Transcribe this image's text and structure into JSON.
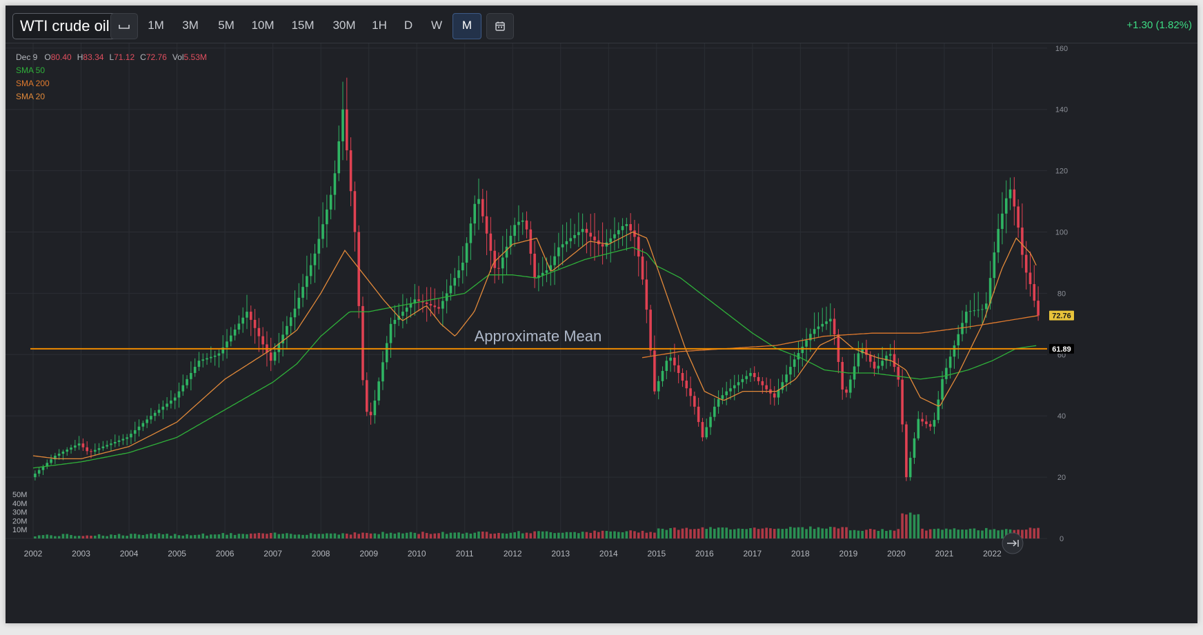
{
  "toolbar": {
    "symbol": "WTI crude oil",
    "intervals": [
      "1M",
      "3M",
      "5M",
      "10M",
      "15M",
      "30M",
      "1H",
      "D",
      "W",
      "M"
    ],
    "active_interval": "M",
    "change": "+1.30 (1.82%)"
  },
  "legend": {
    "date": "Dec 9",
    "open_label": "O",
    "open": "80.40",
    "high_label": "H",
    "high": "83.34",
    "low_label": "L",
    "low": "71.12",
    "close_label": "C",
    "close": "72.76",
    "vol_label": "Vol",
    "vol": "5.53M",
    "sma50": "SMA 50",
    "sma200": "SMA 200",
    "sma20": "SMA 20"
  },
  "annotation": "Approximate Mean",
  "colors": {
    "background": "#1f2126",
    "up": "#2fb463",
    "down": "#e04152",
    "sma50": "#2fb13a",
    "sma200": "#e07a2e",
    "sma20": "#e38a3a",
    "mean_line": "#f08c00",
    "grid": "#2b2e34"
  },
  "icons": [
    "range-icon",
    "calendar-icon",
    "scroll-to-latest-icon"
  ],
  "chart_data": {
    "type": "candlestick",
    "interval": "monthly",
    "x_labels": [
      "2002",
      "2003",
      "2004",
      "2005",
      "2006",
      "2007",
      "2008",
      "2009",
      "2010",
      "2011",
      "2012",
      "2013",
      "2014",
      "2015",
      "2016",
      "2017",
      "2018",
      "2019",
      "2020",
      "2021",
      "2022"
    ],
    "ylim": [
      0,
      160
    ],
    "y_ticks": [
      0,
      20,
      40,
      60,
      80,
      100,
      120,
      140,
      160
    ],
    "volume_ticks": [
      "50M",
      "40M",
      "30M",
      "20M",
      "10M"
    ],
    "volume_max": 50,
    "mean_line": 61.89,
    "last_close": 72.76,
    "mean_label": "61.89",
    "last_label": "72.76",
    "close_anchors": [
      [
        2002.0,
        20
      ],
      [
        2002.5,
        27
      ],
      [
        2003.0,
        31
      ],
      [
        2003.2,
        28
      ],
      [
        2003.5,
        30
      ],
      [
        2004.0,
        33
      ],
      [
        2004.5,
        40
      ],
      [
        2005.0,
        46
      ],
      [
        2005.5,
        58
      ],
      [
        2005.9,
        60
      ],
      [
        2006.5,
        74
      ],
      [
        2007.0,
        58
      ],
      [
        2007.5,
        75
      ],
      [
        2007.9,
        92
      ],
      [
        2008.3,
        115
      ],
      [
        2008.5,
        140
      ],
      [
        2008.75,
        100
      ],
      [
        2008.95,
        42
      ],
      [
        2009.1,
        40
      ],
      [
        2009.5,
        70
      ],
      [
        2010.0,
        78
      ],
      [
        2010.5,
        75
      ],
      [
        2011.0,
        90
      ],
      [
        2011.3,
        113
      ],
      [
        2011.7,
        86
      ],
      [
        2012.1,
        103
      ],
      [
        2012.3,
        104
      ],
      [
        2012.5,
        85
      ],
      [
        2012.8,
        88
      ],
      [
        2013.0,
        95
      ],
      [
        2013.5,
        101
      ],
      [
        2013.9,
        95
      ],
      [
        2014.4,
        103
      ],
      [
        2014.6,
        98
      ],
      [
        2014.8,
        80
      ],
      [
        2015.0,
        48
      ],
      [
        2015.3,
        60
      ],
      [
        2015.8,
        45
      ],
      [
        2016.0,
        33
      ],
      [
        2016.3,
        45
      ],
      [
        2016.5,
        48
      ],
      [
        2017.0,
        54
      ],
      [
        2017.5,
        46
      ],
      [
        2017.9,
        58
      ],
      [
        2018.3,
        68
      ],
      [
        2018.7,
        72
      ],
      [
        2018.95,
        45
      ],
      [
        2019.3,
        63
      ],
      [
        2019.6,
        55
      ],
      [
        2019.9,
        61
      ],
      [
        2020.1,
        51
      ],
      [
        2020.25,
        20
      ],
      [
        2020.5,
        39
      ],
      [
        2020.8,
        36
      ],
      [
        2021.0,
        52
      ],
      [
        2021.5,
        74
      ],
      [
        2021.9,
        75
      ],
      [
        2022.15,
        100
      ],
      [
        2022.4,
        115
      ],
      [
        2022.55,
        105
      ],
      [
        2022.7,
        89
      ],
      [
        2022.9,
        80
      ],
      [
        2022.95,
        72.76
      ]
    ],
    "sma50_anchors": [
      [
        2002.0,
        23
      ],
      [
        2003.0,
        25
      ],
      [
        2004.0,
        28
      ],
      [
        2005.0,
        33
      ],
      [
        2006.0,
        42
      ],
      [
        2007.0,
        51
      ],
      [
        2007.5,
        57
      ],
      [
        2008.0,
        66
      ],
      [
        2008.6,
        74
      ],
      [
        2009.0,
        74
      ],
      [
        2010.0,
        77
      ],
      [
        2011.0,
        80
      ],
      [
        2011.5,
        86
      ],
      [
        2012.0,
        86
      ],
      [
        2012.5,
        85
      ],
      [
        2013.0,
        88
      ],
      [
        2013.5,
        91
      ],
      [
        2014.0,
        93
      ],
      [
        2014.5,
        95
      ],
      [
        2014.8,
        93
      ],
      [
        2015.0,
        89
      ],
      [
        2015.5,
        85
      ],
      [
        2016.0,
        79
      ],
      [
        2016.5,
        73
      ],
      [
        2017.0,
        67
      ],
      [
        2017.5,
        62
      ],
      [
        2018.0,
        59
      ],
      [
        2018.5,
        55
      ],
      [
        2019.0,
        54
      ],
      [
        2019.5,
        54
      ],
      [
        2020.0,
        53
      ],
      [
        2020.5,
        52
      ],
      [
        2021.0,
        53
      ],
      [
        2021.5,
        55
      ],
      [
        2022.0,
        58
      ],
      [
        2022.5,
        62
      ],
      [
        2022.95,
        63
      ]
    ],
    "sma200_anchors": [
      [
        2014.7,
        59
      ],
      [
        2015.5,
        61
      ],
      [
        2016.5,
        62
      ],
      [
        2017.5,
        63
      ],
      [
        2018.5,
        66
      ],
      [
        2019.5,
        67
      ],
      [
        2020.5,
        67
      ],
      [
        2021.5,
        69
      ],
      [
        2022.95,
        72.7
      ]
    ],
    "sma20_anchors": [
      [
        2002.0,
        27
      ],
      [
        2002.5,
        26
      ],
      [
        2003.0,
        26
      ],
      [
        2004.0,
        30
      ],
      [
        2005.0,
        38
      ],
      [
        2006.0,
        52
      ],
      [
        2007.0,
        62
      ],
      [
        2007.5,
        68
      ],
      [
        2008.0,
        80
      ],
      [
        2008.5,
        94
      ],
      [
        2008.9,
        86
      ],
      [
        2009.3,
        78
      ],
      [
        2009.7,
        71
      ],
      [
        2010.2,
        76
      ],
      [
        2010.5,
        70
      ],
      [
        2010.8,
        66
      ],
      [
        2011.2,
        74
      ],
      [
        2011.6,
        90
      ],
      [
        2012.0,
        96
      ],
      [
        2012.5,
        98
      ],
      [
        2012.8,
        87
      ],
      [
        2013.2,
        92
      ],
      [
        2013.6,
        97
      ],
      [
        2014.0,
        96
      ],
      [
        2014.5,
        100
      ],
      [
        2014.8,
        98
      ],
      [
        2015.2,
        80
      ],
      [
        2015.6,
        62
      ],
      [
        2016.0,
        48
      ],
      [
        2016.4,
        45
      ],
      [
        2016.8,
        48
      ],
      [
        2017.5,
        48
      ],
      [
        2017.9,
        52
      ],
      [
        2018.4,
        63
      ],
      [
        2018.8,
        66
      ],
      [
        2019.1,
        62
      ],
      [
        2019.6,
        59
      ],
      [
        2019.9,
        58
      ],
      [
        2020.2,
        55
      ],
      [
        2020.5,
        46
      ],
      [
        2020.9,
        43
      ],
      [
        2021.3,
        54
      ],
      [
        2021.8,
        70
      ],
      [
        2022.2,
        88
      ],
      [
        2022.5,
        98
      ],
      [
        2022.8,
        93
      ],
      [
        2022.95,
        88
      ]
    ]
  }
}
